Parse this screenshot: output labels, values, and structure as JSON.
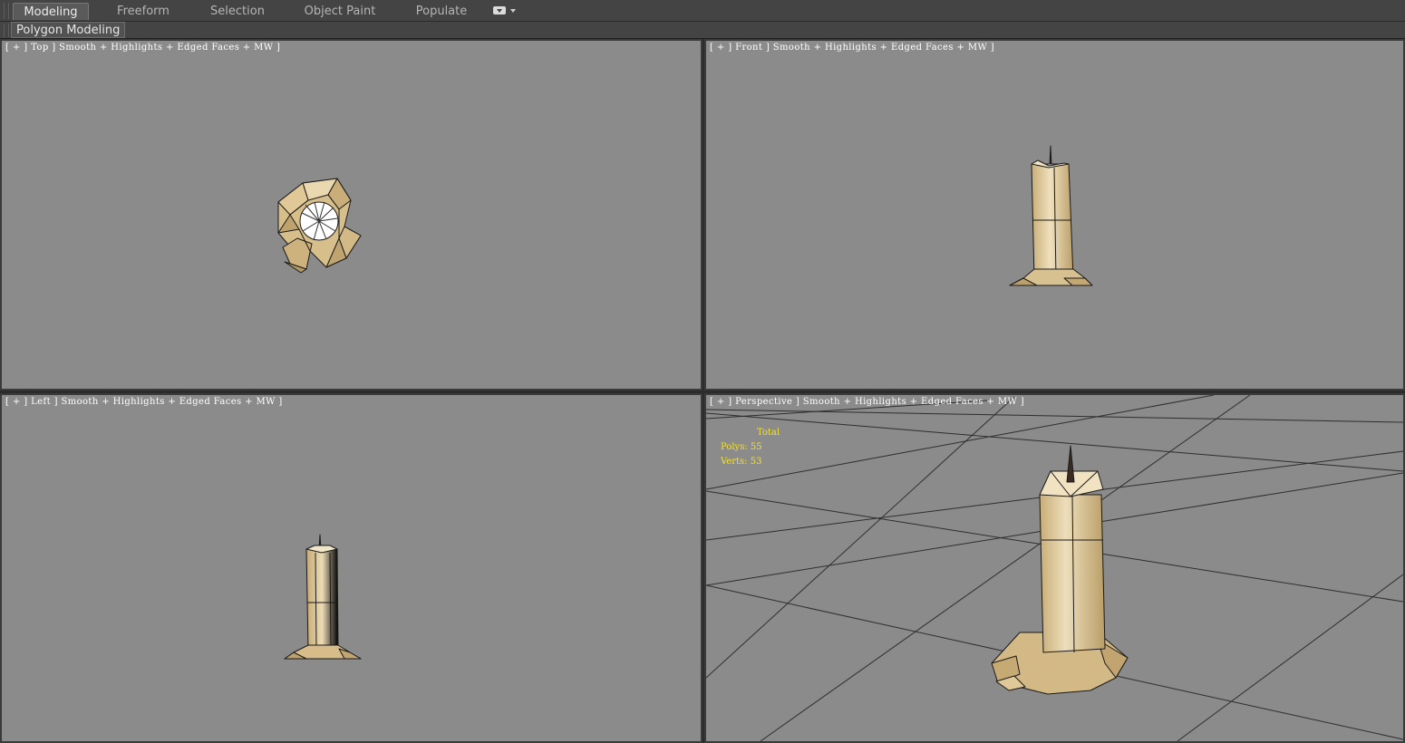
{
  "ribbon": {
    "tabs": [
      {
        "label": "Modeling",
        "active": true
      },
      {
        "label": "Freeform",
        "active": false
      },
      {
        "label": "Selection",
        "active": false
      },
      {
        "label": "Object Paint",
        "active": false
      },
      {
        "label": "Populate",
        "active": false
      }
    ]
  },
  "panel": {
    "button_label": "Polygon Modeling"
  },
  "viewports": {
    "top": {
      "label": "[ + ] Top ] Smooth + Highlights + Edged Faces + MW ]"
    },
    "front": {
      "label": "[ + ] Front ] Smooth + Highlights + Edged Faces + MW ]"
    },
    "left": {
      "label": "[ + ] Left ] Smooth + Highlights + Edged Faces + MW ]"
    },
    "perspective": {
      "label": "[ + ] Perspective ] Smooth + Highlights + Edged Faces + MW ]",
      "stats": {
        "title": "Total",
        "polys": "Polys: 55",
        "verts": "Verts: 53"
      }
    }
  },
  "colors": {
    "viewport_bg": "#8b8b8b",
    "wax": "#e6d2a6",
    "wax_shade": "#c7ae7a",
    "stats_text": "#f5e12a"
  }
}
